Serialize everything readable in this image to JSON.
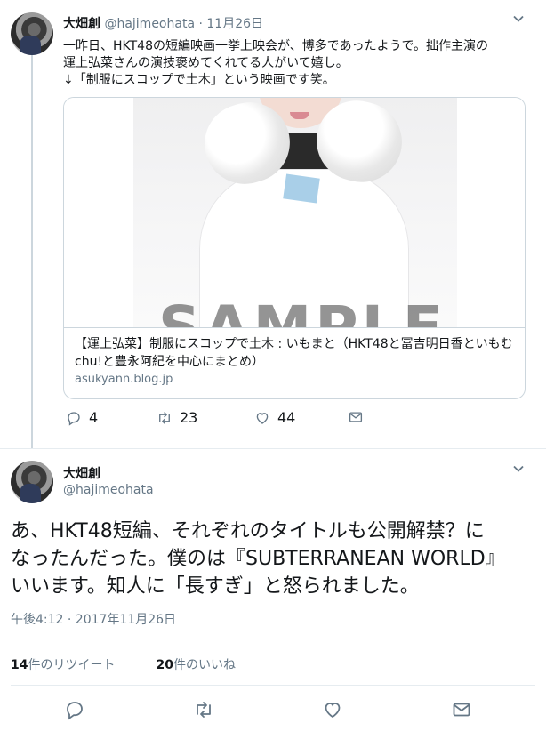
{
  "tweet1": {
    "name": "大畑創",
    "handle": "@hajimeohata",
    "separator": "·",
    "date": "11月26日",
    "text_lines": [
      "一昨日、HKT48の短編映画一挙上映会が、博多であったようで。拙作主演の",
      "運上弘菜さんの演技褒めてくれてる人がいて嬉し。",
      "↓「制服にスコップで土木」という映画です笑。"
    ],
    "card": {
      "image_watermark": "SAMPLE",
      "title": "【運上弘菜】制服にスコップで土木 : いもまと（HKT48と冨吉明日香といもむchu!と豊永阿紀を中心にまとめ）",
      "url": "asukyann.blog.jp"
    },
    "actions": {
      "reply_count": "4",
      "retweet_count": "23",
      "like_count": "44"
    }
  },
  "tweet2": {
    "name": "大畑創",
    "handle": "@hajimeohata",
    "text_lines": [
      "あ、HKT48短編、それぞれのタイトルも公開解禁？に",
      "なったんだった。僕のは『SUBTERRANEAN WORLD』",
      "いいます。知人に「長すぎ」と怒られました。"
    ],
    "timestamp": "午後4:12 · 2017年11月26日",
    "stats": {
      "retweets_num": "14",
      "retweets_label": "件のリツイート",
      "likes_num": "20",
      "likes_label": "件のいいね"
    }
  },
  "colors": {
    "text": "#14171a",
    "muted": "#657786",
    "border": "#ccd6dd",
    "separator": "#e6ecf0"
  },
  "icons": [
    "chevron-down-icon",
    "reply-icon",
    "retweet-icon",
    "like-icon",
    "message-icon"
  ]
}
